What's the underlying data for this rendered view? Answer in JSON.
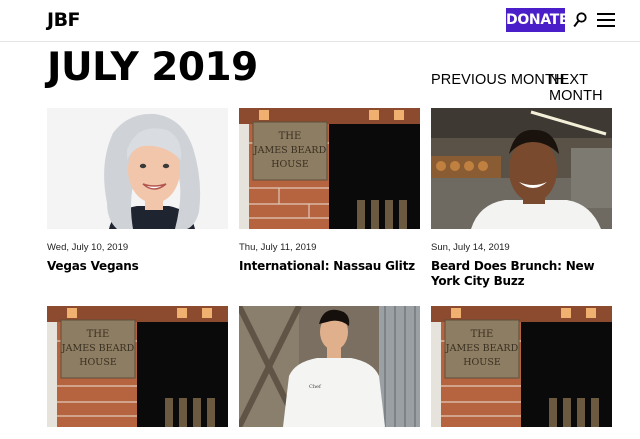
{
  "header": {
    "logo": "JBF",
    "donate_label": "DONATE",
    "search_icon": "search-icon",
    "menu_icon": "hamburger-menu-icon"
  },
  "page": {
    "title": "JULY 2019",
    "prev_label": "PREVIOUS MONTH",
    "next_label": "NEXT MONTH"
  },
  "colors": {
    "donate_bg": "#4a1fc9",
    "text": "#000000"
  },
  "events": [
    {
      "date": "Wed, July 10, 2019",
      "title": "Vegas Vegans",
      "image": "woman-portrait"
    },
    {
      "date": "Thu, July 11, 2019",
      "title": "International: Nassau Glitz",
      "image": "james-beard-house"
    },
    {
      "date": "Sun, July 14, 2019",
      "title": "Beard Does Brunch: New York City Buzz",
      "image": "chef-portrait-kitchen"
    },
    {
      "date": "",
      "title": "",
      "image": "james-beard-house"
    },
    {
      "date": "",
      "title": "",
      "image": "chef-portrait-wood"
    },
    {
      "date": "",
      "title": "",
      "image": "james-beard-house"
    }
  ],
  "house_sign": {
    "line1": "THE",
    "line2": "JAMES BEARD",
    "line3": "HOUSE"
  },
  "chef_jacket_text": "Chef"
}
